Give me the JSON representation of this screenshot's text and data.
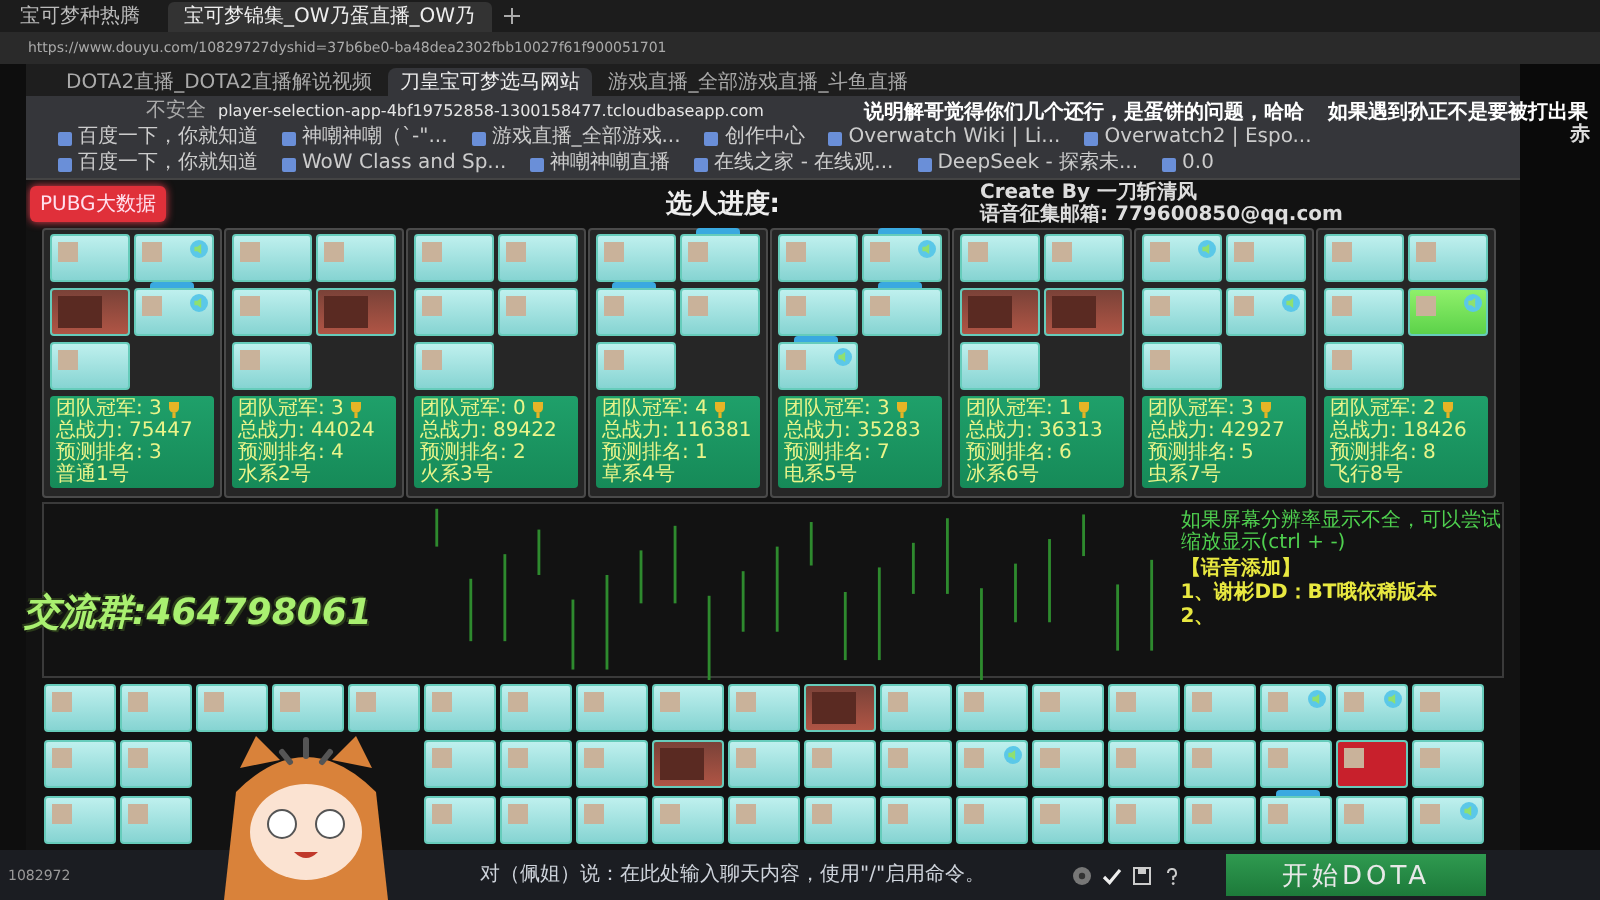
{
  "outer_tabs": [
    {
      "title": "宝可梦种热腾",
      "selected": false
    },
    {
      "title": "宝可梦锦集_OW乃蛋直播_OW乃",
      "selected": true
    }
  ],
  "outer_url": "https://www.douyu.com/10829727dyshid=37b6be0-ba48dea2302fbb10027f61f900051701",
  "overlay": {
    "caption_left": "说明解哥觉得你们几个还行，是蛋饼的问题，哈哈",
    "caption_right": "如果遇到孙正不是要被打出果",
    "caption_edge": "赤",
    "group": "交流群:464798061"
  },
  "inner_tabs": [
    {
      "title": "DOTA2直播_DOTA2直播解说视频",
      "selected": false
    },
    {
      "title": "刀皇宝可梦选马网站",
      "selected": true
    },
    {
      "title": "游戏直播_全部游戏直播_斗鱼直播",
      "selected": false
    }
  ],
  "inner_url": {
    "security": "不安全",
    "address": "player-selection-app-4bf19752858-1300158477.tcloudbaseapp.com"
  },
  "bookmarks": [
    "百度一下，你就知道",
    "神嘲神嘲（`-\"...",
    "游戏直播_全部游戏...",
    "创作中心",
    "Overwatch Wiki | Li...",
    "Overwatch2 | Espo...",
    "百度一下，你就知道",
    "WoW Class and Sp...",
    "神嘲神嘲直播",
    "在线之家 - 在线观...",
    "DeepSeek - 探索未...",
    "0.0"
  ],
  "page": {
    "data_button": "PUBG大数据",
    "title": "选人进度:",
    "credit": "Create By 一刀斩清风",
    "email": "语音征集邮箱: 779600850@qq.com",
    "teams": [
      {
        "champions": "团队冠军: 3",
        "power": "总战力: 75447 预测排名: 3",
        "name": "普通1号",
        "players": [
          {
            "kind": "plain",
            "speaker": false,
            "tagged": false
          },
          {
            "kind": "plain",
            "speaker": true,
            "tagged": false
          },
          {
            "kind": "image",
            "speaker": false,
            "tagged": false
          },
          {
            "kind": "plain",
            "speaker": true,
            "tagged": true
          },
          {
            "kind": "plain",
            "speaker": false,
            "tagged": false
          }
        ]
      },
      {
        "champions": "团队冠军: 3",
        "power": "总战力: 44024 预测排名: 4",
        "name": "水系2号",
        "players": [
          {
            "kind": "plain",
            "speaker": false,
            "tagged": false
          },
          {
            "kind": "plain",
            "speaker": false,
            "tagged": false
          },
          {
            "kind": "plain",
            "speaker": false,
            "tagged": false
          },
          {
            "kind": "image",
            "speaker": false,
            "tagged": false
          },
          {
            "kind": "plain",
            "speaker": false,
            "tagged": false
          }
        ]
      },
      {
        "champions": "团队冠军: 0",
        "power": "总战力: 89422 预测排名: 2",
        "name": "火系3号",
        "players": [
          {
            "kind": "plain",
            "speaker": false,
            "tagged": false
          },
          {
            "kind": "plain",
            "speaker": false,
            "tagged": false
          },
          {
            "kind": "plain",
            "speaker": false,
            "tagged": false
          },
          {
            "kind": "plain",
            "speaker": false,
            "tagged": false
          },
          {
            "kind": "plain",
            "speaker": false,
            "tagged": false
          }
        ]
      },
      {
        "champions": "团队冠军: 4",
        "power": "总战力: 116381 预测排名: 1",
        "name": "草系4号",
        "players": [
          {
            "kind": "plain",
            "speaker": false,
            "tagged": false
          },
          {
            "kind": "plain",
            "speaker": false,
            "tagged": true
          },
          {
            "kind": "plain",
            "speaker": false,
            "tagged": true
          },
          {
            "kind": "plain",
            "speaker": false,
            "tagged": false
          },
          {
            "kind": "plain",
            "speaker": false,
            "tagged": false
          }
        ]
      },
      {
        "champions": "团队冠军: 3",
        "power": "总战力: 35283 预测排名: 7",
        "name": "电系5号",
        "players": [
          {
            "kind": "plain",
            "speaker": false,
            "tagged": false
          },
          {
            "kind": "plain",
            "speaker": true,
            "tagged": true
          },
          {
            "kind": "plain",
            "speaker": false,
            "tagged": false
          },
          {
            "kind": "plain",
            "speaker": false,
            "tagged": true
          },
          {
            "kind": "plain",
            "speaker": true,
            "tagged": true
          }
        ]
      },
      {
        "champions": "团队冠军: 1",
        "power": "总战力: 36313 预测排名: 6",
        "name": "冰系6号",
        "players": [
          {
            "kind": "plain",
            "speaker": false,
            "tagged": false
          },
          {
            "kind": "plain",
            "speaker": false,
            "tagged": false
          },
          {
            "kind": "image",
            "speaker": false,
            "tagged": false
          },
          {
            "kind": "image",
            "speaker": false,
            "tagged": false
          },
          {
            "kind": "plain",
            "speaker": false,
            "tagged": false
          }
        ]
      },
      {
        "champions": "团队冠军: 3",
        "power": "总战力: 42927 预测排名: 5",
        "name": "虫系7号",
        "players": [
          {
            "kind": "plain",
            "speaker": true,
            "tagged": false
          },
          {
            "kind": "plain",
            "speaker": false,
            "tagged": false
          },
          {
            "kind": "plain",
            "speaker": false,
            "tagged": false
          },
          {
            "kind": "plain",
            "speaker": true,
            "tagged": false
          },
          {
            "kind": "plain",
            "speaker": false,
            "tagged": false
          }
        ]
      },
      {
        "champions": "团队冠军: 2",
        "power": "总战力: 18426 预测排名: 8",
        "name": "飞行8号",
        "players": [
          {
            "kind": "plain",
            "speaker": false,
            "tagged": false
          },
          {
            "kind": "plain",
            "speaker": false,
            "tagged": false
          },
          {
            "kind": "plain",
            "speaker": false,
            "tagged": false
          },
          {
            "kind": "green",
            "speaker": true,
            "tagged": false
          },
          {
            "kind": "plain",
            "speaker": false,
            "tagged": false
          }
        ]
      }
    ],
    "notice": "如果屏幕分辨率显示不全，可以尝试缩放显示(ctrl + -)",
    "voice_title": "【语音添加】",
    "voice_items": [
      "1、谢彬DD：BT哦依稀版本",
      "2、"
    ],
    "pool_rows": [
      [
        {
          "kind": "plain",
          "speaker": false,
          "tagged": false
        },
        {
          "kind": "plain",
          "speaker": false,
          "tagged": false
        },
        {
          "kind": "plain",
          "speaker": false,
          "tagged": false
        },
        {
          "kind": "plain",
          "speaker": false,
          "tagged": false
        },
        {
          "kind": "plain",
          "speaker": false,
          "tagged": false
        },
        {
          "kind": "plain",
          "speaker": false,
          "tagged": false
        },
        {
          "kind": "plain",
          "speaker": false,
          "tagged": false
        },
        {
          "kind": "plain",
          "speaker": false,
          "tagged": false
        },
        {
          "kind": "plain",
          "speaker": false,
          "tagged": false
        },
        {
          "kind": "plain",
          "speaker": false,
          "tagged": false
        },
        {
          "kind": "image",
          "speaker": false,
          "tagged": false
        },
        {
          "kind": "plain",
          "speaker": false,
          "tagged": false
        },
        {
          "kind": "plain",
          "speaker": false,
          "tagged": false
        },
        {
          "kind": "plain",
          "speaker": false,
          "tagged": false
        },
        {
          "kind": "plain",
          "speaker": false,
          "tagged": false
        },
        {
          "kind": "plain",
          "speaker": false,
          "tagged": false
        },
        {
          "kind": "plain",
          "speaker": true,
          "tagged": false
        },
        {
          "kind": "plain",
          "speaker": true,
          "tagged": false
        },
        {
          "kind": "plain",
          "speaker": false,
          "tagged": false
        }
      ],
      [
        {
          "kind": "plain",
          "speaker": false,
          "tagged": false
        },
        {
          "kind": "plain",
          "speaker": false,
          "tagged": false
        },
        {
          "kind": "covered"
        },
        {
          "kind": "covered"
        },
        {
          "kind": "covered"
        },
        {
          "kind": "plain",
          "speaker": false,
          "tagged": false
        },
        {
          "kind": "plain",
          "speaker": false,
          "tagged": false
        },
        {
          "kind": "plain",
          "speaker": false,
          "tagged": false
        },
        {
          "kind": "image",
          "speaker": false,
          "tagged": false
        },
        {
          "kind": "plain",
          "speaker": false,
          "tagged": false
        },
        {
          "kind": "plain",
          "speaker": false,
          "tagged": false
        },
        {
          "kind": "plain",
          "speaker": false,
          "tagged": false
        },
        {
          "kind": "plain",
          "speaker": true,
          "tagged": false
        },
        {
          "kind": "plain",
          "speaker": false,
          "tagged": false
        },
        {
          "kind": "plain",
          "speaker": false,
          "tagged": false
        },
        {
          "kind": "plain",
          "speaker": false,
          "tagged": false
        },
        {
          "kind": "plain",
          "speaker": false,
          "tagged": false
        },
        {
          "kind": "red",
          "speaker": false,
          "tagged": false
        },
        {
          "kind": "plain",
          "speaker": false,
          "tagged": false
        }
      ],
      [
        {
          "kind": "plain",
          "speaker": false,
          "tagged": false
        },
        {
          "kind": "plain",
          "speaker": false,
          "tagged": false
        },
        {
          "kind": "covered"
        },
        {
          "kind": "covered"
        },
        {
          "kind": "covered"
        },
        {
          "kind": "plain",
          "speaker": false,
          "tagged": false
        },
        {
          "kind": "plain",
          "speaker": false,
          "tagged": false
        },
        {
          "kind": "plain",
          "speaker": false,
          "tagged": false
        },
        {
          "kind": "plain",
          "speaker": false,
          "tagged": false
        },
        {
          "kind": "plain",
          "speaker": false,
          "tagged": false
        },
        {
          "kind": "plain",
          "speaker": false,
          "tagged": false
        },
        {
          "kind": "plain",
          "speaker": false,
          "tagged": false
        },
        {
          "kind": "plain",
          "speaker": false,
          "tagged": false
        },
        {
          "kind": "plain",
          "speaker": false,
          "tagged": false
        },
        {
          "kind": "plain",
          "speaker": false,
          "tagged": false
        },
        {
          "kind": "plain",
          "speaker": false,
          "tagged": false
        },
        {
          "kind": "plain",
          "speaker": false,
          "tagged": true
        },
        {
          "kind": "plain",
          "speaker": false,
          "tagged": false
        },
        {
          "kind": "plain",
          "speaker": true,
          "tagged": false
        }
      ]
    ]
  },
  "chat": {
    "placeholder": "对（佩姐）说：在此处输入聊天内容，使用\"/\"启用命令。"
  },
  "start_button": "开始DOTA",
  "room_id": "1082972"
}
